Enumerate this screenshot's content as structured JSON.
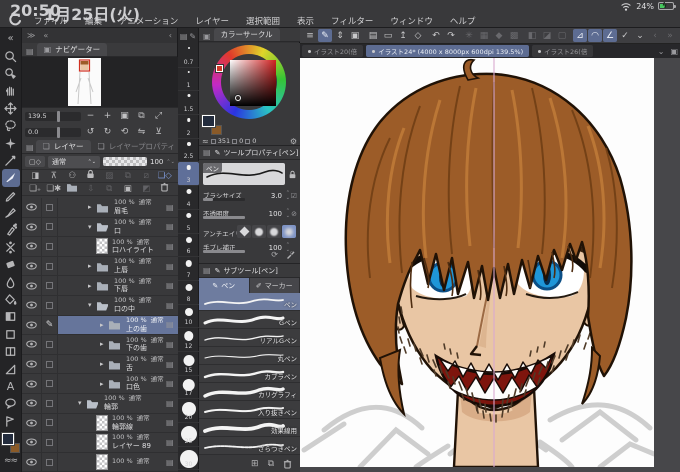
{
  "statusbar": {
    "time": "20:50",
    "date": "1月25日(火)",
    "battery": "24%"
  },
  "menubar": {
    "items": [
      "ファイル",
      "編集",
      "アニメーション",
      "レイヤー",
      "選択範囲",
      "表示",
      "フィルター",
      "ウィンドウ",
      "ヘルプ"
    ]
  },
  "navigator": {
    "title": "ナビゲーター",
    "zoom_value": "139.5",
    "rotate_value": "0.0"
  },
  "brush_sizes": {
    "values": [
      "0.7",
      "1",
      "1.5",
      "2",
      "2.5",
      "3",
      "4",
      "5",
      "6",
      "7",
      "8",
      "10",
      "12",
      "15",
      "17",
      "20",
      "25",
      "30"
    ],
    "selected": "3"
  },
  "color_panel": {
    "title": "カラーサークル",
    "hue": "351",
    "saturation": "0",
    "value": "0"
  },
  "tool_property": {
    "title": "ツールプロパティ[ペン]",
    "preview_label": "ペン",
    "rows": [
      {
        "label": "ブラシサイズ",
        "value": "3.0"
      },
      {
        "label": "不透明度",
        "value": "100"
      },
      {
        "label": "アンチエイリアス",
        "value": ""
      },
      {
        "label": "手ブレ補正",
        "value": "100"
      }
    ]
  },
  "sub_tool": {
    "title": "サブツール[ペン]",
    "tabs": [
      "ペン",
      "マーカー"
    ],
    "selected": "ペン",
    "items": [
      "ペン",
      "Gペン",
      "リアルGペン",
      "丸ペン",
      "カブラペン",
      "カリグラフィ",
      "入り抜きペン",
      "効果線用",
      "ざらつきペン"
    ]
  },
  "layers_panel": {
    "tab_layer": "レイヤー",
    "tab_property": "レイヤープロパティ",
    "blend_mode": "通常",
    "opacity": "100",
    "rows": [
      {
        "percent": "100 %",
        "blend": "通常",
        "name": "眉毛"
      },
      {
        "percent": "100 %",
        "blend": "通常",
        "name": "口"
      },
      {
        "percent": "100 %",
        "blend": "通常",
        "name": "口ハイライト"
      },
      {
        "percent": "100 %",
        "blend": "通常",
        "name": "上唇"
      },
      {
        "percent": "100 %",
        "blend": "通常",
        "name": "下唇"
      },
      {
        "percent": "100 %",
        "blend": "通常",
        "name": "口の中"
      },
      {
        "percent": "100 %",
        "blend": "通常",
        "name": "上の歯"
      },
      {
        "percent": "100 %",
        "blend": "通常",
        "name": "下の歯"
      },
      {
        "percent": "100 %",
        "blend": "通常",
        "name": "舌"
      },
      {
        "percent": "100 %",
        "blend": "通常",
        "name": "口色"
      },
      {
        "percent": "100 %",
        "blend": "通常",
        "name": "輪郭"
      },
      {
        "percent": "100 %",
        "blend": "通常",
        "name": "輪郭線"
      },
      {
        "percent": "100 %",
        "blend": "通常",
        "name": "レイヤー 89"
      },
      {
        "percent": "100 %",
        "blend": "通常",
        "name": ""
      }
    ]
  },
  "canvas": {
    "tabs": [
      {
        "label": "イラスト20(倍",
        "active": false
      },
      {
        "label": "イラスト24* (4000 x 8000px 600dpi 139.5%)",
        "active": true
      },
      {
        "label": "イラスト26(倍",
        "active": false
      }
    ],
    "colors": {
      "skin": "#e9c6a4",
      "shadow": "#d2a37c",
      "hair": "#9c5c28",
      "hairdark": "#6e3d14",
      "hairlight": "#c17c39",
      "outline": "#201206",
      "iris": "#1f96d8",
      "irisdark": "#0c4f86",
      "mouth": "#7e150d",
      "teeth": "#fdfdfb",
      "guide": "#d9a9d0",
      "sketch": "#c6c6c6",
      "stubble": "#4f3b28"
    }
  }
}
